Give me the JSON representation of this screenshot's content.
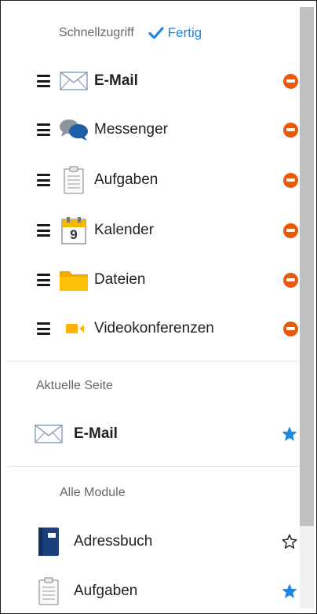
{
  "quick_access": {
    "title": "Schnellzugriff",
    "done_label": "Fertig",
    "items": [
      {
        "label": "E-Mail",
        "bold": true,
        "icon": "envelope-icon"
      },
      {
        "label": "Messenger",
        "icon": "chat-bubbles-icon"
      },
      {
        "label": "Aufgaben",
        "icon": "clipboard-icon"
      },
      {
        "label": "Kalender",
        "icon": "calendar-icon",
        "calendar_day": "9"
      },
      {
        "label": "Dateien",
        "icon": "folder-icon"
      },
      {
        "label": "Videokonferenzen",
        "icon": "video-camera-icon"
      }
    ]
  },
  "current_page": {
    "title": "Aktuelle Seite",
    "item": {
      "label": "E-Mail",
      "icon": "envelope-icon",
      "favorite": true
    }
  },
  "all_modules": {
    "title": "Alle Module",
    "items": [
      {
        "label": "Adressbuch",
        "icon": "address-book-icon",
        "favorite": false
      },
      {
        "label": "Aufgaben",
        "icon": "clipboard-icon",
        "favorite": true
      }
    ]
  },
  "colors": {
    "accent": "#1e88e5",
    "remove": "#e8590c",
    "favorite": "#1e88e5"
  }
}
